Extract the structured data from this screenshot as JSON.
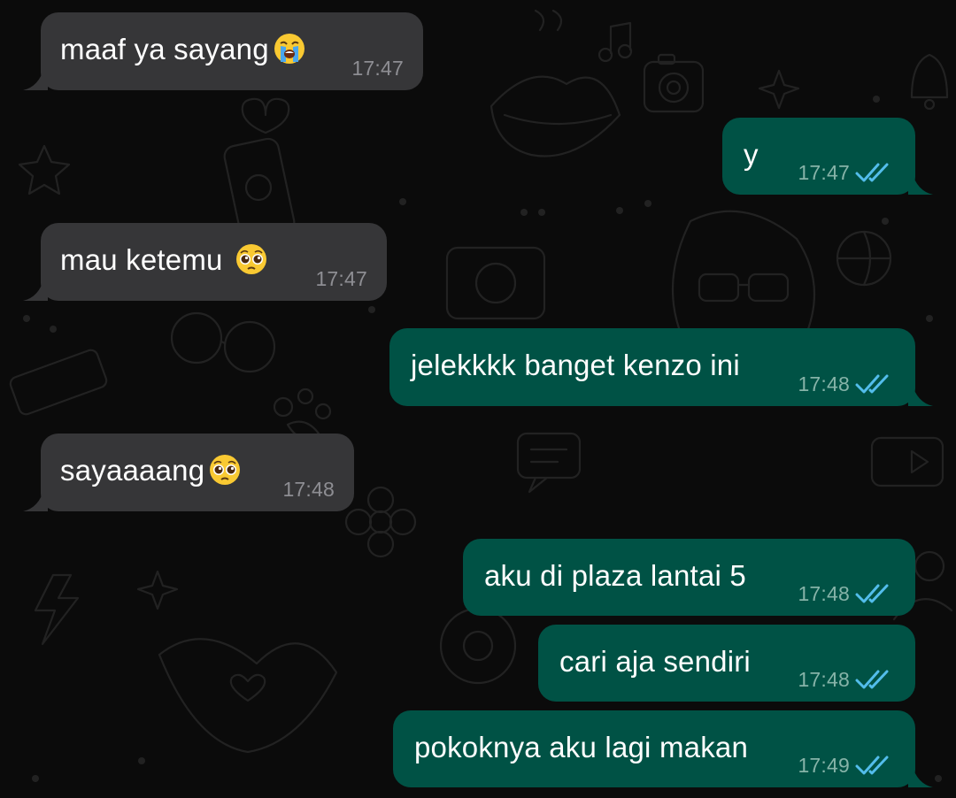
{
  "colors": {
    "background": "#0b0b0b",
    "incoming_bubble": "#363638",
    "outgoing_bubble": "#005245",
    "read_ticks": "#53bdeb",
    "text": "#ffffff"
  },
  "messages": [
    {
      "direction": "in",
      "text": "maaf ya sayang",
      "emoji": "loudly-crying-face",
      "time": "17:47"
    },
    {
      "direction": "out",
      "text": "y",
      "time": "17:47",
      "status": "read"
    },
    {
      "direction": "in",
      "text": "mau ketemu ",
      "emoji": "pleading-face",
      "time": "17:47"
    },
    {
      "direction": "out",
      "text": "jelekkkk banget kenzo ini",
      "time": "17:48",
      "status": "read"
    },
    {
      "direction": "in",
      "text": "sayaaaang",
      "emoji": "pleading-face",
      "time": "17:48"
    },
    {
      "direction": "out",
      "text": "aku di plaza lantai 5",
      "time": "17:48",
      "status": "read"
    },
    {
      "direction": "out",
      "text": "cari aja sendiri",
      "time": "17:48",
      "status": "read"
    },
    {
      "direction": "out",
      "text": "pokoknya aku lagi makan",
      "time": "17:49",
      "status": "read"
    }
  ]
}
